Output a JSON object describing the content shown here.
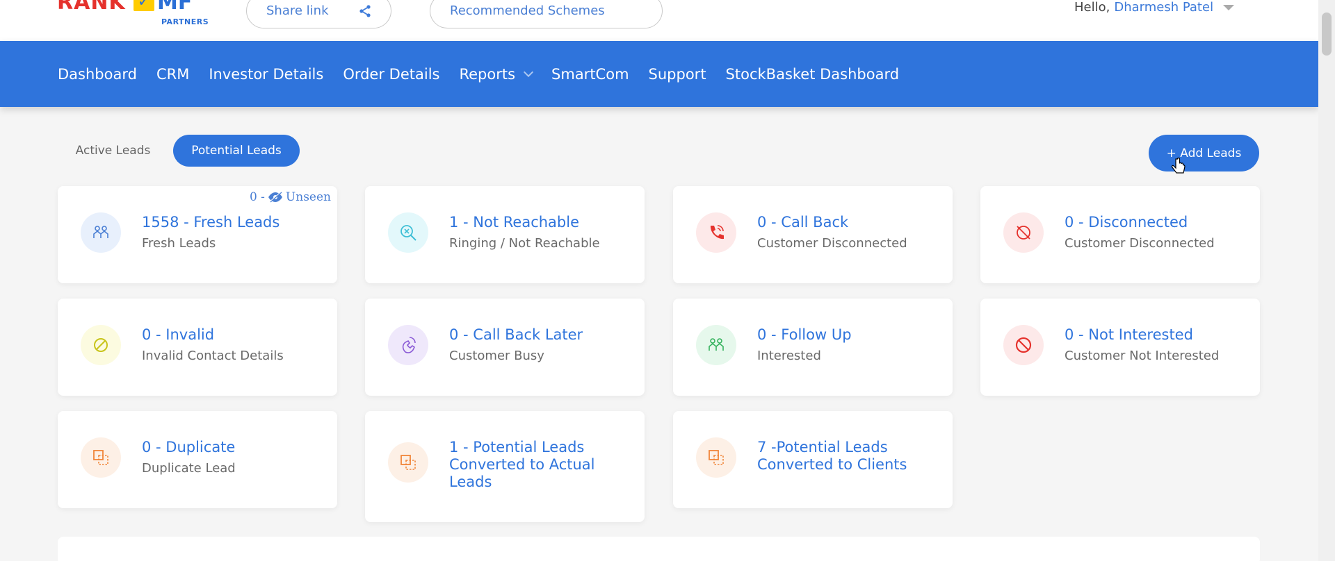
{
  "header": {
    "logo": {
      "rank": "RANK",
      "mf": "MF",
      "partners": "PARTNERS"
    },
    "share_link": "Share link",
    "recommended": "Recommended Schemes",
    "hello": "Hello,",
    "user_name": "Dharmesh Patel"
  },
  "nav": {
    "items": [
      "Dashboard",
      "CRM",
      "Investor Details",
      "Order Details",
      "Reports",
      "SmartCom",
      "Support",
      "StockBasket Dashboard"
    ]
  },
  "tabs": {
    "active_leads": "Active Leads",
    "potential_leads": "Potential Leads"
  },
  "add_leads": "+ Add Leads",
  "unseen": {
    "count": "0 -",
    "label": "Unseen"
  },
  "cards": [
    {
      "title": "1558 - Fresh Leads",
      "sub": "Fresh Leads",
      "icon": "people-icon",
      "color": "#e8f0fc",
      "stroke": "#4a7fd4"
    },
    {
      "title": "1 - Not Reachable",
      "sub": "Ringing / Not Reachable",
      "icon": "search-x-icon",
      "color": "#e3f8fb",
      "stroke": "#3fbfd6"
    },
    {
      "title": "0 - Call Back",
      "sub": "Customer Disconnected",
      "icon": "phone-icon",
      "color": "#fde9e9",
      "stroke": "#e5322d"
    },
    {
      "title": "0 - Disconnected",
      "sub": "Customer Disconnected",
      "icon": "disconnected-icon",
      "color": "#fde9e9",
      "stroke": "#e5322d"
    },
    {
      "title": "0 - Invalid",
      "sub": "Invalid Contact Details",
      "icon": "invalid-icon",
      "color": "#fcfbe0",
      "stroke": "#c8c41a"
    },
    {
      "title": "0 - Call Back Later",
      "sub": "Customer Busy",
      "icon": "busy-icon",
      "color": "#efe8fb",
      "stroke": "#8a5ad6"
    },
    {
      "title": "0 - Follow Up",
      "sub": "Interested",
      "icon": "people-icon",
      "color": "#e6f8ec",
      "stroke": "#36b35e"
    },
    {
      "title": "0 - Not Interested",
      "sub": "Customer Not Interested",
      "icon": "ban-icon",
      "color": "#fde9e9",
      "stroke": "#e5322d"
    },
    {
      "title": "0 - Duplicate",
      "sub": "Duplicate Lead",
      "icon": "duplicate-icon",
      "color": "#fdf0e6",
      "stroke": "#f0863a"
    },
    {
      "title": "1 - Potential Leads Converted to Actual Leads",
      "sub": "",
      "icon": "duplicate-icon",
      "color": "#fdf0e6",
      "stroke": "#f0863a"
    },
    {
      "title": "7 -Potential Leads Converted to Clients",
      "sub": "",
      "icon": "duplicate-icon",
      "color": "#fdf0e6",
      "stroke": "#f0863a"
    }
  ]
}
